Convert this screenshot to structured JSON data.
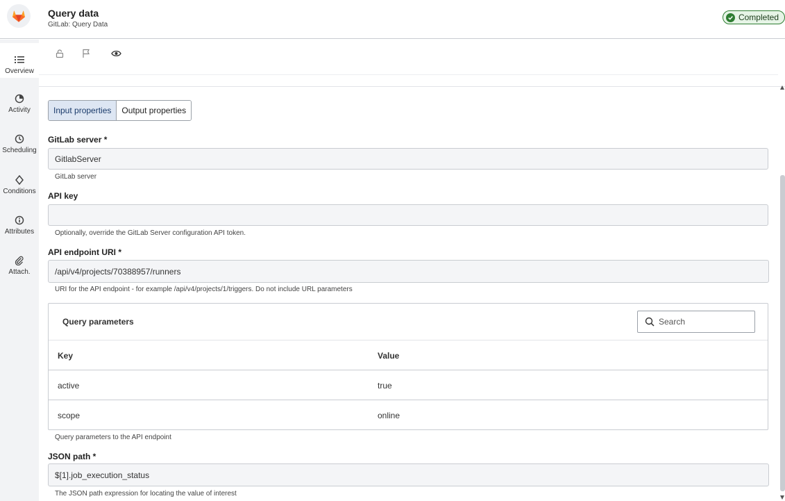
{
  "header": {
    "title": "Query data",
    "subtitle": "GitLab: Query Data",
    "status": "Completed",
    "status_color": "#2e7d32"
  },
  "sidebar": {
    "items": [
      {
        "label": "Overview",
        "icon": "list-icon"
      },
      {
        "label": "Activity",
        "icon": "pie-chart-icon"
      },
      {
        "label": "Scheduling",
        "icon": "clock-icon"
      },
      {
        "label": "Conditions",
        "icon": "diamond-icon"
      },
      {
        "label": "Attributes",
        "icon": "info-icon"
      },
      {
        "label": "Attach.",
        "icon": "paperclip-icon"
      }
    ]
  },
  "toolbar_icons": [
    "lock-icon",
    "flag-icon",
    "eye-icon"
  ],
  "tabs": {
    "input": "Input properties",
    "output": "Output properties"
  },
  "form": {
    "server": {
      "label": "GitLab server *",
      "value": "GitlabServer",
      "help": "GitLab server"
    },
    "api_key": {
      "label": "API key",
      "value": "",
      "help": "Optionally, override the GitLab Server configuration API token."
    },
    "endpoint": {
      "label": "API endpoint URI *",
      "value": "/api/v4/projects/70388957/runners",
      "help": "URI for the API endpoint - for example /api/v4/projects/1/triggers. Do not include URL parameters"
    },
    "query_params": {
      "title": "Query parameters",
      "search_placeholder": "Search",
      "columns": [
        "Key",
        "Value"
      ],
      "rows": [
        {
          "key": "active",
          "value": "true"
        },
        {
          "key": "scope",
          "value": "online"
        }
      ],
      "help": "Query parameters to the API endpoint"
    },
    "json_path": {
      "label": "JSON path *",
      "value": "$[1].job_execution_status",
      "help": "The JSON path expression for locating the value of interest"
    }
  }
}
